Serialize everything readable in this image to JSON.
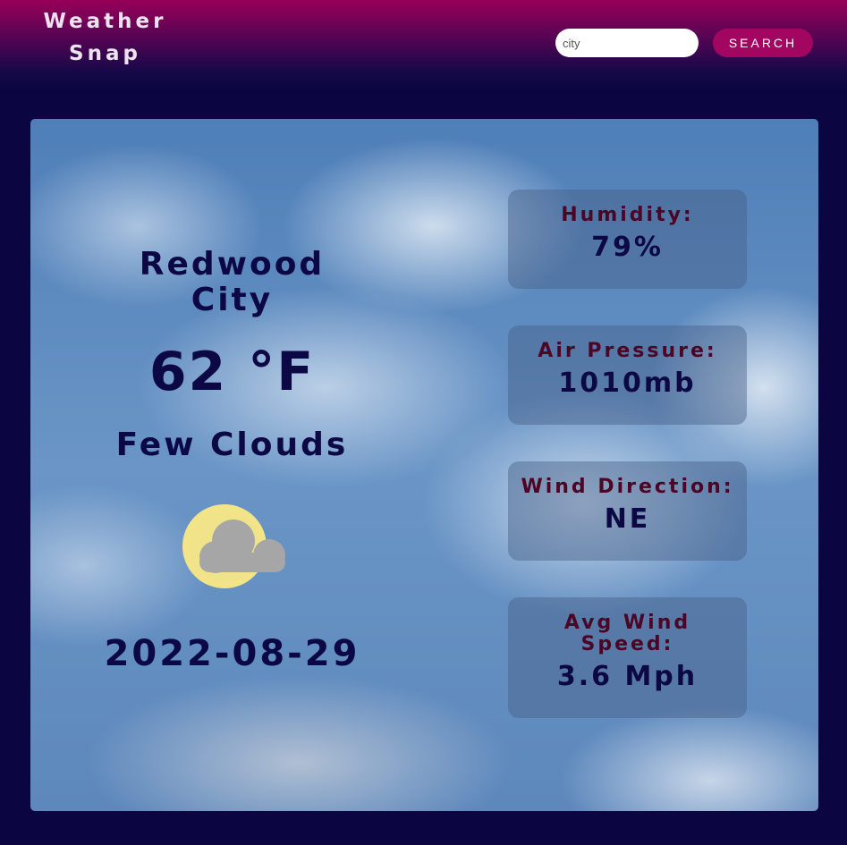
{
  "header": {
    "brand": "Weather\nSnap",
    "search": {
      "placeholder": "city",
      "value": "",
      "button_label": "SEARCH"
    }
  },
  "current": {
    "city": "Redwood\nCity",
    "temperature": "62 °F",
    "description": "Few Clouds",
    "icon": "few-clouds-icon",
    "date": "2022-08-29"
  },
  "stats": [
    {
      "label": "Humidity:",
      "value": "79%"
    },
    {
      "label": "Air Pressure:",
      "value": "1010mb"
    },
    {
      "label": "Wind Direction:",
      "value": "NE"
    },
    {
      "label": "Avg Wind\nSpeed:",
      "value": "3.6 Mph"
    }
  ],
  "colors": {
    "page_background": "#0b0642",
    "header_accent": "#960058",
    "search_button": "#a30660",
    "text_primary": "#0c0845",
    "stat_label": "#4d0526",
    "sun": "#f3e487",
    "cloud": "#a6a6a6"
  }
}
